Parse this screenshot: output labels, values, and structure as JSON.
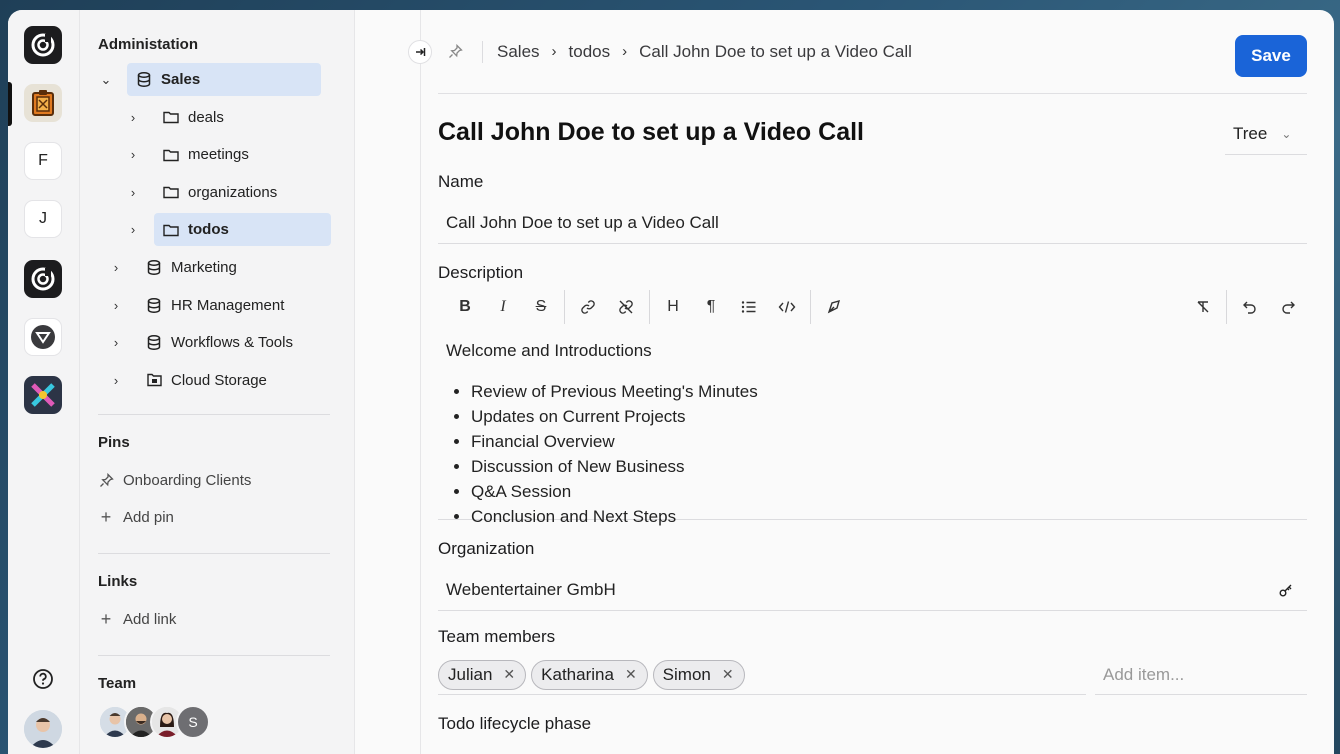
{
  "rail": {
    "letters": [
      "F",
      "J"
    ],
    "help_icon": "help-circle-icon"
  },
  "sidebar": {
    "admin_title": "Administation",
    "tree": {
      "root": "Sales",
      "children": [
        "deals",
        "meetings",
        "organizations",
        "todos"
      ],
      "others": [
        "Marketing",
        "HR Management",
        "Workflows & Tools",
        "Cloud Storage"
      ]
    },
    "pins_title": "Pins",
    "pins": [
      "Onboarding Clients"
    ],
    "add_pin": "Add pin",
    "links_title": "Links",
    "add_link": "Add link",
    "team_title": "Team",
    "team_last_initial": "S"
  },
  "breadcrumb": [
    "Sales",
    "todos",
    "Call John Doe to set up a Video Call"
  ],
  "save_label": "Save",
  "page_title": "Call John Doe to set up a Video Call",
  "view_mode": "Tree",
  "fields": {
    "name_label": "Name",
    "name_value": "Call John Doe to set up a Video Call",
    "description_label": "Description",
    "description_intro": "Welcome and Introductions",
    "description_items": [
      "Review of Previous Meeting's Minutes",
      "Updates on Current Projects",
      "Financial Overview",
      "Discussion of New Business",
      "Q&A Session",
      "Conclusion and Next Steps"
    ],
    "organization_label": "Organization",
    "organization_value": "Webentertainer GmbH",
    "team_label": "Team members",
    "team_members": [
      "Julian",
      "Katharina",
      "Simon"
    ],
    "add_item_placeholder": "Add item...",
    "lifecycle_label": "Todo lifecycle phase"
  },
  "colors": {
    "accent": "#1a64d8",
    "selected_bg": "#d8e4f6"
  }
}
